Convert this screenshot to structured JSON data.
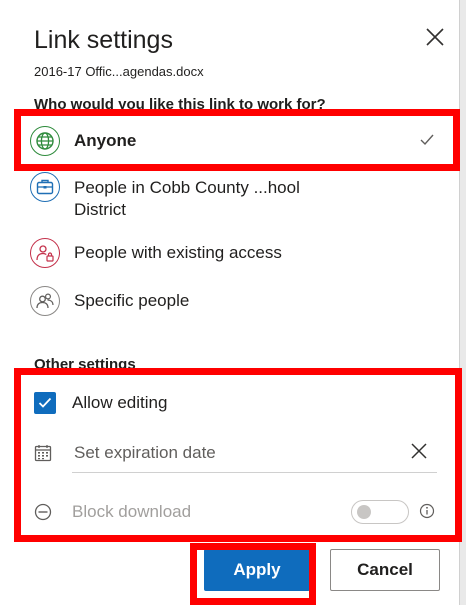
{
  "dialog": {
    "title": "Link settings",
    "filename": "2016-17 Offic...agendas.docx",
    "close_icon": "close-icon"
  },
  "audience": {
    "heading": "Who would you like this link to work for?",
    "options": [
      {
        "label": "Anyone",
        "icon": "globe-icon",
        "selected": true
      },
      {
        "label": "People in Cobb County ...hool District",
        "icon": "organization-icon",
        "selected": false
      },
      {
        "label": "People with existing access",
        "icon": "people-lock-icon",
        "selected": false
      },
      {
        "label": "Specific people",
        "icon": "people-icon",
        "selected": false
      }
    ]
  },
  "other_settings": {
    "heading": "Other settings",
    "allow_editing": {
      "label": "Allow editing",
      "checked": true
    },
    "expiration": {
      "placeholder": "Set expiration date",
      "icon": "calendar-icon"
    },
    "block_download": {
      "label": "Block download",
      "enabled": false,
      "icon": "block-icon"
    }
  },
  "actions": {
    "apply": "Apply",
    "cancel": "Cancel"
  },
  "colors": {
    "accent": "#0f6cbd",
    "highlight": "#ff0000"
  }
}
